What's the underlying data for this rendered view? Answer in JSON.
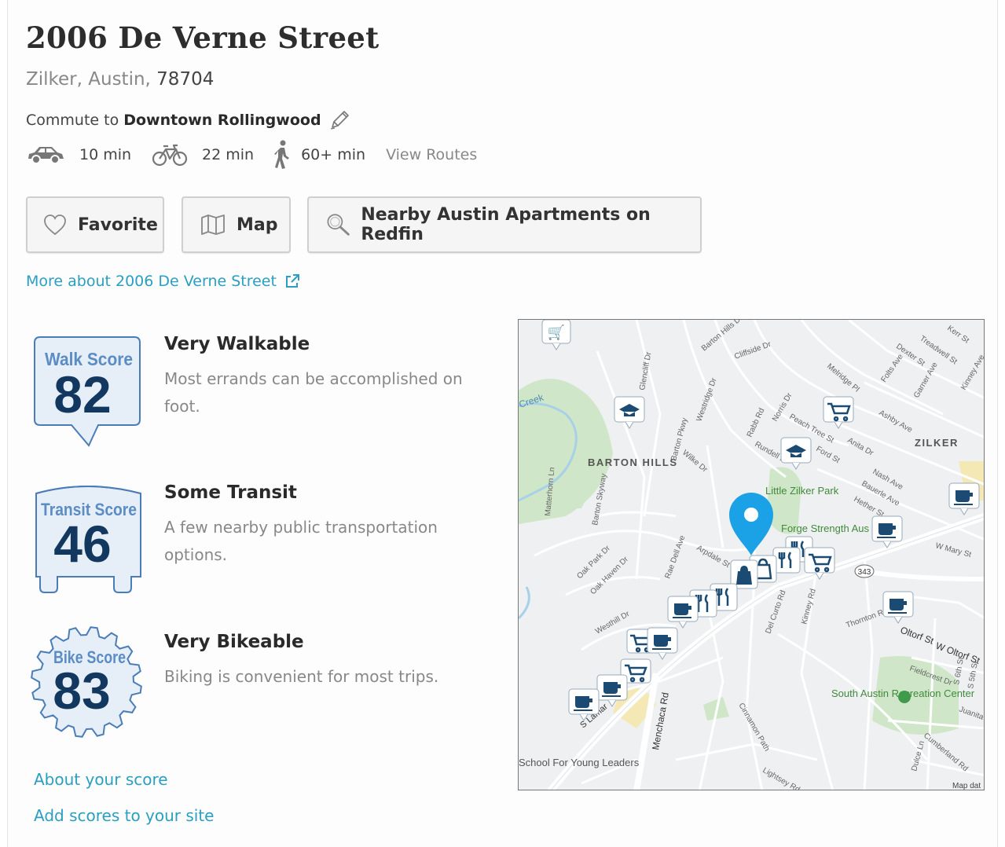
{
  "address": {
    "street": "2006 De Verne Street",
    "neighborhood_city": "Zilker, Austin,",
    "zip": "78704"
  },
  "commute": {
    "prefix": "Commute to",
    "destination": "Downtown Rollingwood",
    "modes": [
      {
        "icon": "car-icon",
        "time": "10 min"
      },
      {
        "icon": "bike-icon",
        "time": "22 min"
      },
      {
        "icon": "walk-icon",
        "time": "60+ min"
      }
    ],
    "view_routes": "View Routes"
  },
  "actions": {
    "favorite": "Favorite",
    "map": "Map",
    "nearby": "Nearby Austin Apartments on Redfin"
  },
  "more_link": "More about 2006 De Verne Street",
  "scores": [
    {
      "label": "Walk Score",
      "value": "82",
      "heading": "Very Walkable",
      "description": "Most errands can be accomplished on foot."
    },
    {
      "label": "Transit Score",
      "value": "46",
      "heading": "Some Transit",
      "description": "A few nearby public transportation options."
    },
    {
      "label": "Bike Score",
      "value": "83",
      "heading": "Very Bikeable",
      "description": "Biking is convenient for most trips."
    }
  ],
  "links": {
    "about": "About your score",
    "add": "Add scores to your site"
  },
  "map": {
    "areas": [
      "BARTON HILLS",
      "ZILKER"
    ],
    "places": [
      "Little Zilker Park",
      "Forge Strength Aus",
      "South Austin Recreation Center",
      "School For Young Leaders",
      "Creek"
    ],
    "streets": [
      "Menchaca Rd",
      "W Oltorf St",
      "Oltorf St",
      "W Mary St",
      "Barton Skyway",
      "Westhill Dr",
      "Oak Park Dr",
      "Oak Haven Dr",
      "Del Curto Rd",
      "Kinney Rd",
      "Thornton Rd",
      "Cinnamon Path",
      "Lightsey Rd",
      "Fieldcrest Dr",
      "Cumberland Rd",
      "Dexter St",
      "Treadwell St",
      "Kerr St",
      "Folts Ave",
      "Garner Ave",
      "Kinney Ave",
      "Ashby Ave",
      "Bauerle Ave",
      "Nash Ave",
      "Hether St",
      "Melridge Pl",
      "Barton Pkwy",
      "Westridge Dr",
      "Wilke Dr",
      "Rae Dell Ave",
      "Arpdale St",
      "Matterhorn Ln",
      "Norris Dr",
      "Rabb Rd",
      "Rundell Pl",
      "Peach Tree St",
      "Ford St",
      "Anita Dr",
      "Cliffside Dr",
      "Glencliff Dr",
      "Barton Hills Dr",
      "S Lamar",
      "Dulce Ln",
      "Juanita",
      "S 5th St",
      "S 6th St"
    ],
    "route_shield": "343",
    "attribution": "Map dat"
  },
  "colors": {
    "link": "#2a9fc1",
    "badge_fill": "#e6eef8",
    "badge_stroke": "#4a7db8",
    "badge_label": "#5b8cc4",
    "badge_value": "#13385f",
    "pin": "#1aa1e6",
    "marker_fill": "#1b4a72",
    "park": "#cfe7c8"
  }
}
